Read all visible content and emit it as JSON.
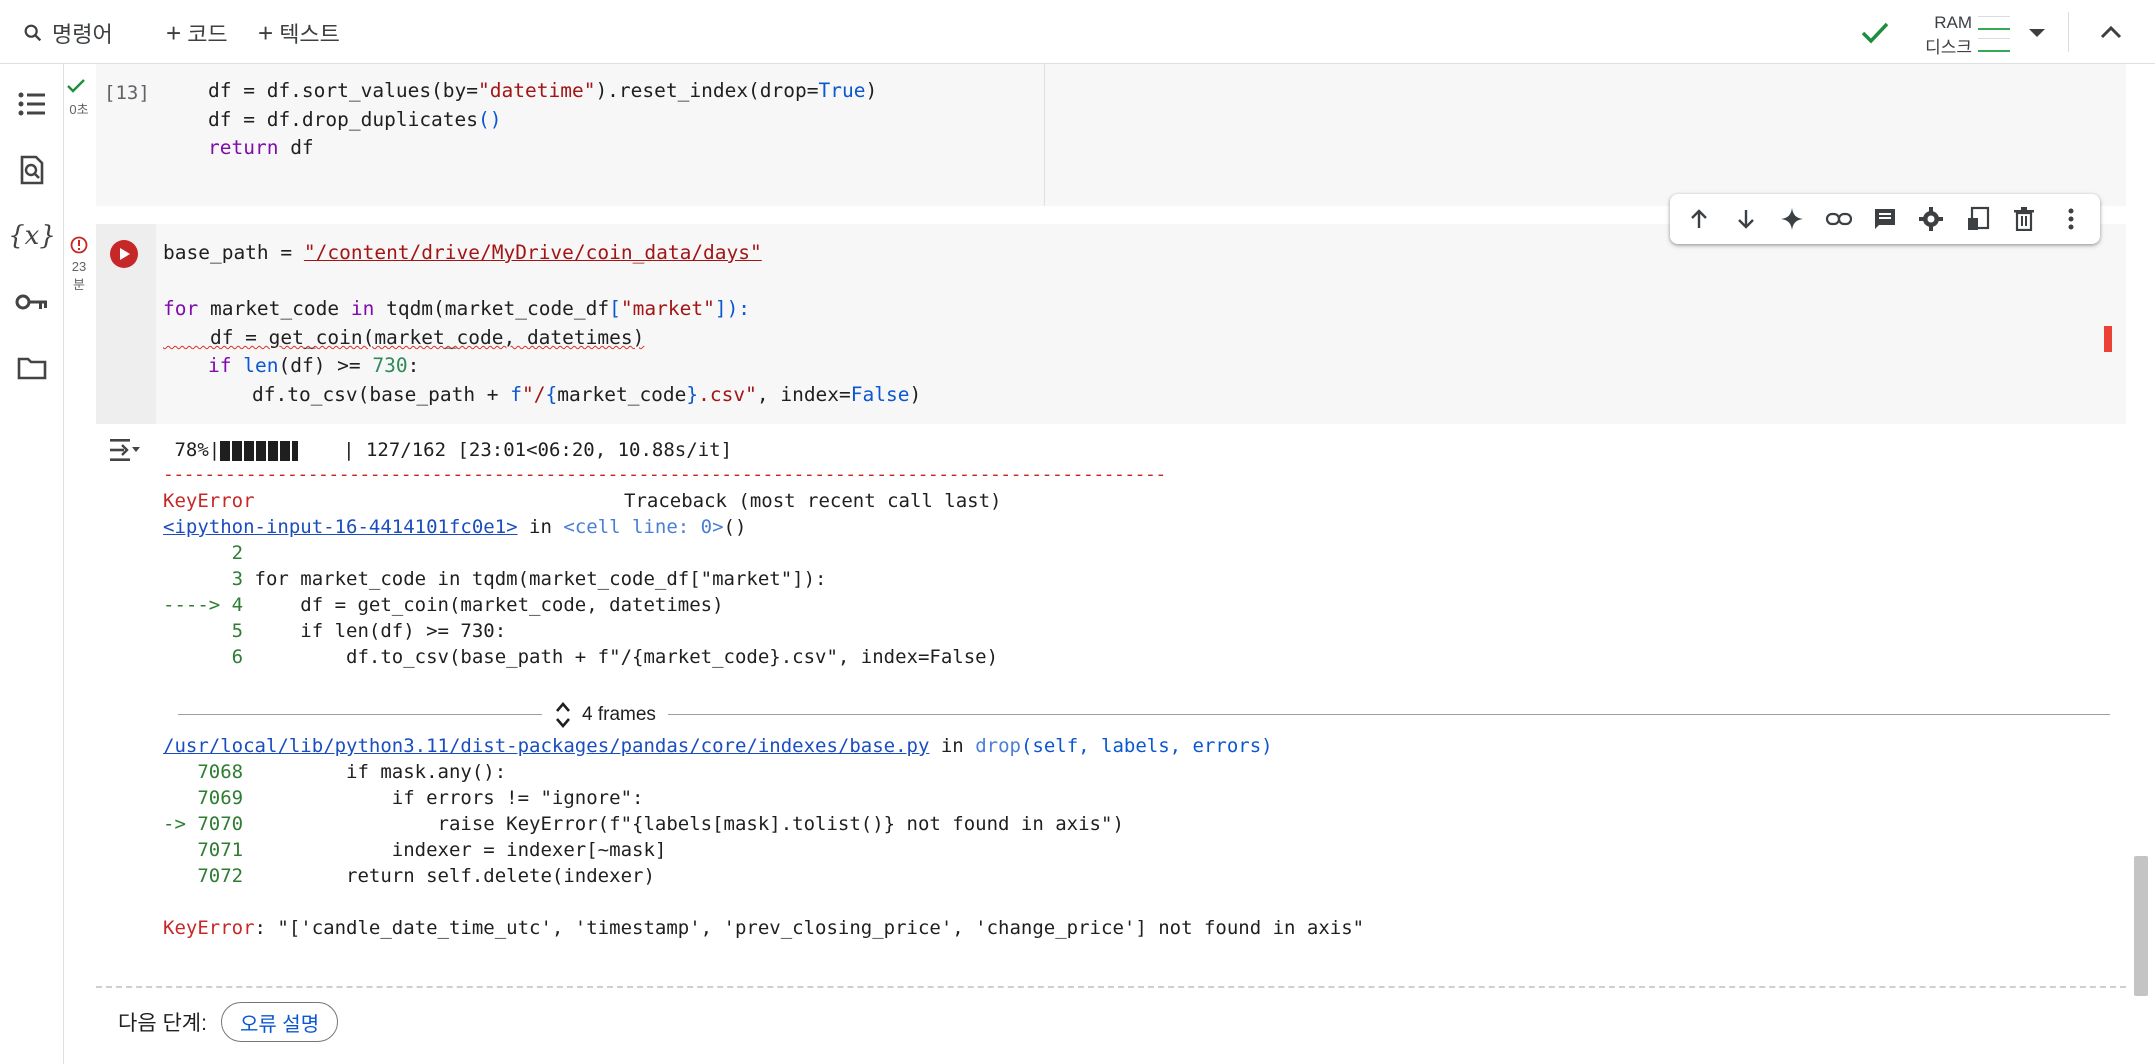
{
  "topbar": {
    "command_label": "명령어",
    "add_code_label": "코드",
    "add_text_label": "텍스트",
    "ram_label": "RAM",
    "disk_label": "디스크",
    "status_color": "#1e8e3e"
  },
  "rail": {
    "icons": [
      "toc-icon",
      "find-icon",
      "variables-icon",
      "secrets-icon",
      "folder-icon"
    ],
    "variables_glyph": "{x}"
  },
  "cell1": {
    "status": "0초",
    "exec_count": "[13]",
    "lines": [
      {
        "t1": "df = df.sort_values(by=",
        "s1": "\"datetime\"",
        "t2": ").reset_index(drop=",
        "k1": "True",
        "t3": ")"
      },
      {
        "t1": "df = df.drop_duplicates",
        "t2": "()"
      },
      {
        "kw": "return",
        "t1": " df"
      }
    ]
  },
  "cell2": {
    "status_time": "23",
    "status_unit": "분",
    "code": {
      "l1_a": "base_path = ",
      "l1_str": "\"/content/drive/MyDrive/coin_data/days\"",
      "l3_for": "for",
      "l3_a": " market_code ",
      "l3_in": "in",
      "l3_b": " tqdm(market_code_df",
      "l3_c": "[",
      "l3_str": "\"market\"",
      "l3_d": "]):",
      "l4": "    df = get_coin(market_code, datetimes)",
      "l5_if": "if",
      "l5_len": "len",
      "l5_a": "(df) >= ",
      "l5_num": "730",
      "l5_b": ":",
      "l6_a": "df.to_csv(base_path + ",
      "l6_f": "f",
      "l6_str1": "\"/",
      "l6_brace1": "{",
      "l6_var": "market_code",
      "l6_brace2": "}",
      "l6_str2": ".csv\"",
      "l6_b": ", index=",
      "l6_false": "False",
      "l6_c": ")"
    }
  },
  "toolbar_buttons": [
    "move-up-icon",
    "move-down-icon",
    "sparkle-icon",
    "link-icon",
    "comment-icon",
    "settings-icon",
    "mirror-cell-icon",
    "delete-icon",
    "more-icon"
  ],
  "output": {
    "progress": {
      "percent_text": " 78%|",
      "tail": "  | 127/162 [23:01<06:20, 10.88s/it]",
      "fraction": 0.78
    },
    "dashes": "-------------------------------------------------------------------------------------------------",
    "err_name": "KeyError",
    "traceback_header": "Traceback (most recent call last)",
    "input_link": "<ipython-input-16-4414101fc0e1>",
    "in_text": " in ",
    "cell_line": "<cell line: 0>",
    "cell_line_paren": "()",
    "tb1": [
      {
        "no": "      2",
        "code": ""
      },
      {
        "no": "      3",
        "code": " for market_code in tqdm(market_code_df[\"market\"]):"
      },
      {
        "no": "----> 4",
        "code": "     df = get_coin(market_code, datetimes)"
      },
      {
        "no": "      5",
        "code": "     if len(df) >= 730:"
      },
      {
        "no": "      6",
        "code": "         df.to_csv(base_path + f\"/{market_code}.csv\", index=False)"
      }
    ],
    "frames_label": "4 frames",
    "path_p1": "/usr/local/lib/",
    "path_p2": "python3.11/dist-packages/pandas/core/indexes/base.py",
    "drop_in": " in ",
    "drop_fn": "drop",
    "drop_args": "(self, labels, errors)",
    "tb2": [
      {
        "no": "   7068",
        "code": "         if mask.any():"
      },
      {
        "no": "   7069",
        "code": "             if errors != \"ignore\":"
      },
      {
        "no": "-> 7070",
        "code": "                 raise KeyError(f\"{labels[mask].tolist()} not found in axis\")"
      },
      {
        "no": "   7071",
        "code": "             indexer = indexer[~mask]"
      },
      {
        "no": "   7072",
        "code": "         return self.delete(indexer)"
      }
    ],
    "final_err_name": "KeyError",
    "final_err_msg": ": \"['candle_date_time_utc', 'timestamp', 'prev_closing_price', 'change_price'] not found in axis\""
  },
  "next_steps": {
    "label": "다음 단계:",
    "chip": "오류 설명"
  }
}
